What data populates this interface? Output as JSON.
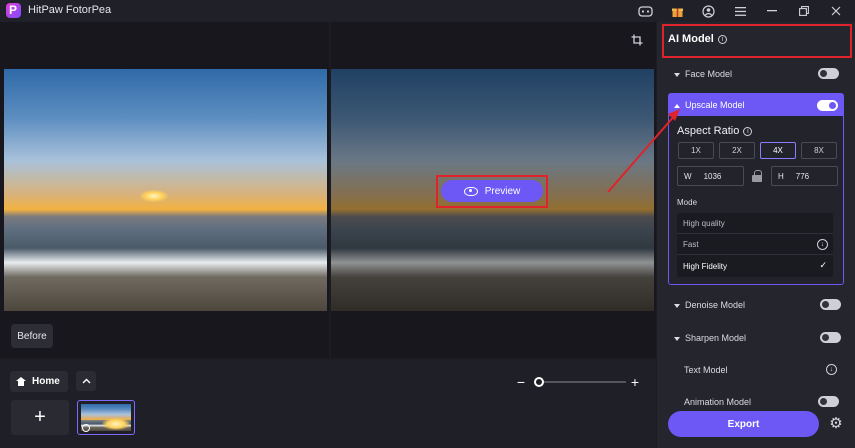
{
  "app": {
    "title": "HitPaw FotorPea",
    "titlebar_icons": [
      "discord-icon",
      "gift-icon",
      "user-icon",
      "menu-icon",
      "minimize-icon",
      "restore-icon",
      "close-icon"
    ]
  },
  "canvas": {
    "before_label": "Before",
    "preview_label": "Preview"
  },
  "bottom": {
    "home_label": "Home",
    "add_label": "+",
    "zoom_minus": "−",
    "zoom_plus": "+",
    "zoom_level": 0
  },
  "panel": {
    "title": "AI Model",
    "info_glyph": "i",
    "models": {
      "face": {
        "label": "Face Model",
        "enabled": false
      },
      "upscale": {
        "label": "Upscale Model",
        "enabled": true
      },
      "denoise": {
        "label": "Denoise Model",
        "enabled": false
      },
      "sharpen": {
        "label": "Sharpen Model",
        "enabled": false
      },
      "text": {
        "label": "Text Model"
      },
      "animation": {
        "label": "Animation Model",
        "enabled": false
      }
    },
    "aspect": {
      "title": "Aspect Ratio",
      "options": [
        "1X",
        "2X",
        "4X",
        "8X"
      ],
      "selected": "4X",
      "width_label": "W",
      "width_value": "1036",
      "height_label": "H",
      "height_value": "776"
    },
    "mode": {
      "label": "Mode",
      "items": [
        "High quality",
        "Fast",
        "High Fidelity"
      ],
      "selected": "High Fidelity"
    },
    "export_label": "Export"
  },
  "colors": {
    "accent": "#6d57f5",
    "highlight": "#e0232a",
    "panel_bg": "#25252e"
  }
}
